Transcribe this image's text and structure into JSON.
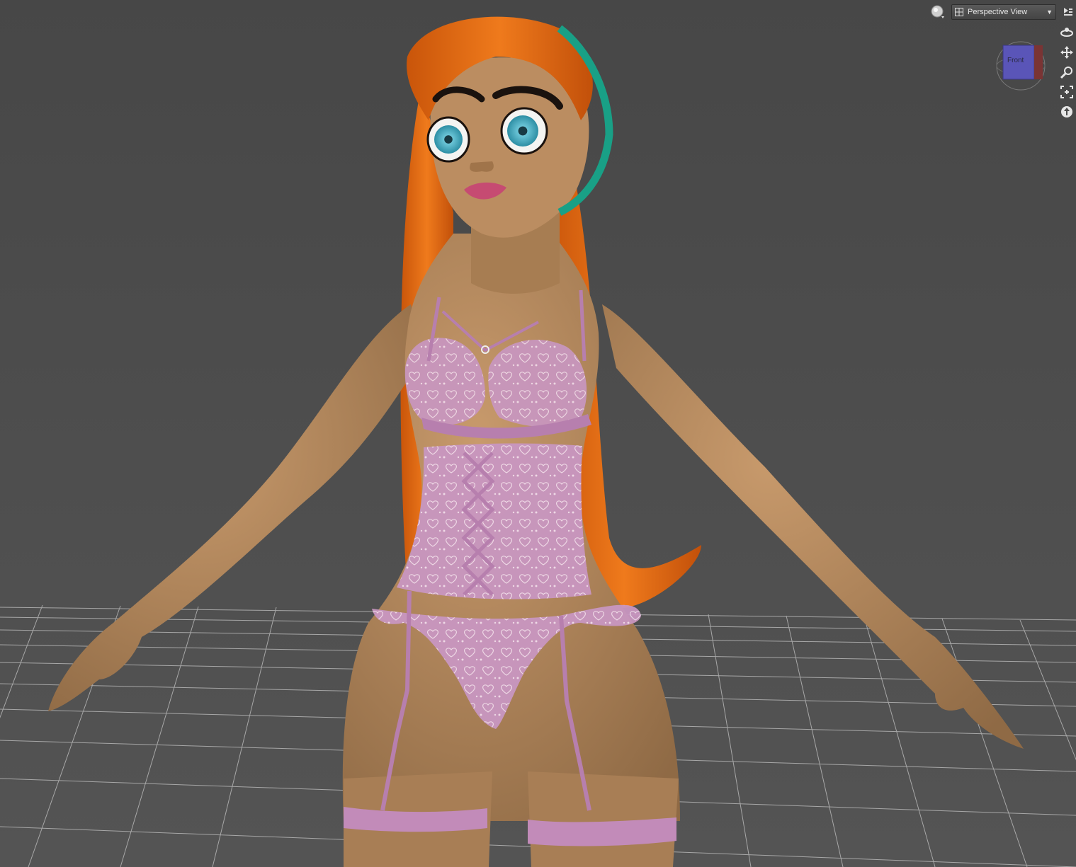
{
  "viewport": {
    "view_label": "Perspective View",
    "cube_face_label": "Front",
    "background_color": "#4b4b4b",
    "grid_color": "#c8c8c8"
  },
  "icons": {
    "render_mode": "sphere-render-icon",
    "view_grid": "grid-icon",
    "view_dropdown": "chevron-down-icon",
    "menu": "viewport-menu-icon",
    "orbit": "orbit-icon",
    "pan": "pan-icon",
    "zoom": "zoom-icon",
    "frame": "frame-icon",
    "reset": "reset-icon"
  },
  "figure": {
    "hair_color": "#e56a10",
    "headband_color": "#19a086",
    "skin_color": "#b98a5e",
    "lingerie_color": "#c08ab8",
    "eye_color": "#4fb3c9",
    "lip_color": "#c64b72"
  }
}
